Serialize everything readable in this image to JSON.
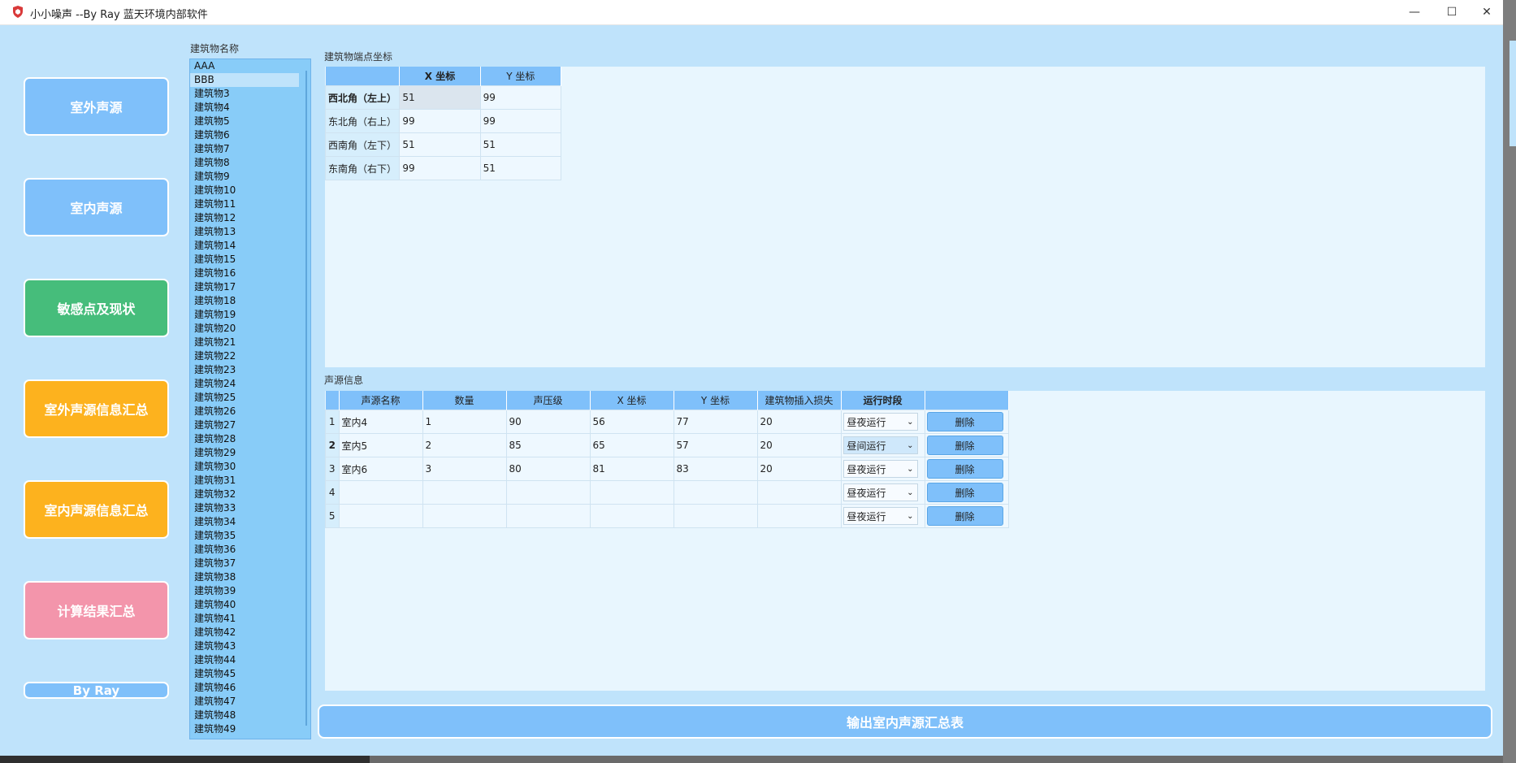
{
  "window": {
    "title": "小小噪声  --By Ray  蓝天环境内部软件",
    "controls": {
      "minimize": "—",
      "maximize": "☐",
      "close": "✕"
    }
  },
  "nav": {
    "outdoor": "室外声源",
    "indoor": "室内声源",
    "sensitive": "敏感点及现状",
    "outdoor_summary": "室外声源信息汇总",
    "indoor_summary": "室内声源信息汇总",
    "results": "计算结果汇总",
    "byray": "By Ray"
  },
  "buildings": {
    "label": "建筑物名称",
    "selected_index": 1,
    "items": [
      "AAA",
      "BBB",
      "建筑物3",
      "建筑物4",
      "建筑物5",
      "建筑物6",
      "建筑物7",
      "建筑物8",
      "建筑物9",
      "建筑物10",
      "建筑物11",
      "建筑物12",
      "建筑物13",
      "建筑物14",
      "建筑物15",
      "建筑物16",
      "建筑物17",
      "建筑物18",
      "建筑物19",
      "建筑物20",
      "建筑物21",
      "建筑物22",
      "建筑物23",
      "建筑物24",
      "建筑物25",
      "建筑物26",
      "建筑物27",
      "建筑物28",
      "建筑物29",
      "建筑物30",
      "建筑物31",
      "建筑物32",
      "建筑物33",
      "建筑物34",
      "建筑物35",
      "建筑物36",
      "建筑物37",
      "建筑物38",
      "建筑物39",
      "建筑物40",
      "建筑物41",
      "建筑物42",
      "建筑物43",
      "建筑物44",
      "建筑物45",
      "建筑物46",
      "建筑物47",
      "建筑物48",
      "建筑物49"
    ]
  },
  "coords": {
    "label": "建筑物端点坐标",
    "headers": [
      "X 坐标",
      "Y 坐标"
    ],
    "rows": [
      {
        "name": "西北角（左上）",
        "x": "51",
        "y": "99"
      },
      {
        "name": "东北角（右上）",
        "x": "99",
        "y": "99"
      },
      {
        "name": "西南角（左下）",
        "x": "51",
        "y": "51"
      },
      {
        "name": "东南角（右下）",
        "x": "99",
        "y": "51"
      }
    ]
  },
  "sources": {
    "label": "声源信息",
    "headers": [
      "声源名称",
      "数量",
      "声压级",
      "X 坐标",
      "Y 坐标",
      "建筑物插入损失",
      "运行时段"
    ],
    "delete_label": "删除",
    "rows": [
      {
        "no": "1",
        "name": "室内4",
        "qty": "1",
        "spl": "90",
        "x": "56",
        "y": "77",
        "loss": "20",
        "period": "昼夜运行"
      },
      {
        "no": "2",
        "name": "室内5",
        "qty": "2",
        "spl": "85",
        "x": "65",
        "y": "57",
        "loss": "20",
        "period": "昼间运行"
      },
      {
        "no": "3",
        "name": "室内6",
        "qty": "3",
        "spl": "80",
        "x": "81",
        "y": "83",
        "loss": "20",
        "period": "昼夜运行"
      },
      {
        "no": "4",
        "name": "",
        "qty": "",
        "spl": "",
        "x": "",
        "y": "",
        "loss": "",
        "period": "昼夜运行"
      },
      {
        "no": "5",
        "name": "",
        "qty": "",
        "spl": "",
        "x": "",
        "y": "",
        "loss": "",
        "period": "昼夜运行"
      }
    ]
  },
  "export_label": "输出室内声源汇总表",
  "colors": {
    "background": "#bfe3fb",
    "accent": "#7fc0fa",
    "green": "#46bd7b",
    "orange": "#fdb21e",
    "pink": "#f395ab"
  }
}
